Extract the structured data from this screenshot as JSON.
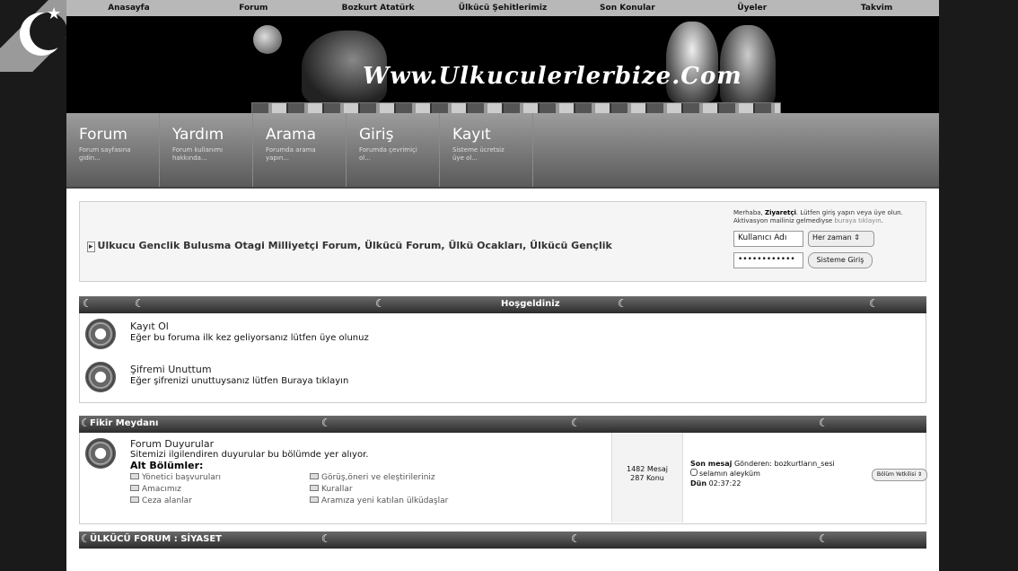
{
  "topnav": [
    "Anasayfa",
    "Forum",
    "Bozkurt Atatürk",
    "Ülkücü Şehitlerimiz",
    "Son Konular",
    "Üyeler",
    "Takvim"
  ],
  "banner": {
    "title": "Www.Ulkuculerlerbize.Com"
  },
  "mainnav": [
    {
      "title": "Forum",
      "sub": "Forum sayfasına gidin..."
    },
    {
      "title": "Yardım",
      "sub": "Forum kullanımı hakkında..."
    },
    {
      "title": "Arama",
      "sub": "Forumda arama yapın..."
    },
    {
      "title": "Giriş",
      "sub": "Forumda çevrimiçi ol..."
    },
    {
      "title": "Kayıt",
      "sub": "Sisteme ücretsiz üye ol..."
    }
  ],
  "login": {
    "site_title": "Ulkucu Genclik Bulusma Otagi Milliyetçi Forum, Ülkücü Forum, Ülkü Ocakları, Ülkücü Gençlik",
    "greeting_pre": "Merhaba, ",
    "greeting_user": "Ziyaretçi",
    "greeting_post": ". Lütfen giriş yapın veya üye olun.",
    "activation_pre": "Aktivasyon mailiniz gelmediyse ",
    "activation_link": "buraya tıklayın",
    "activation_post": ".",
    "username_value": "Kullanıcı Adı",
    "remember_value": "Her zaman",
    "password_value": "••••••••••••",
    "login_button": "Sisteme Giriş"
  },
  "welcome": {
    "title": "Hoşgeldiniz",
    "items": [
      {
        "title": "Kayıt Ol",
        "desc": "Eğer bu foruma ilk kez geliyorsanız lütfen üye olunuz"
      },
      {
        "title": "Şifremi Unuttum",
        "desc": "Eğer şifrenizi unuttuysanız lütfen Buraya tıklayın"
      }
    ]
  },
  "category1": {
    "title": "Fikir Meydanı",
    "forum": {
      "title": "Forum Duyurular",
      "desc": "Sitemizi ilgilendiren duyurular bu bölümde yer alıyor.",
      "sub_label": "Alt Bölümler:",
      "subs": [
        "Yönetici başvuruları",
        "Görüş,öneri ve eleştirileriniz",
        "Amacımız",
        "Kurallar",
        "Ceza alanlar",
        "Aramıza yeni katılan ülküdaşlar"
      ],
      "posts": "1482 Mesaj",
      "topics": "287 Konu",
      "last_label": "Son mesaj",
      "last_sender_pre": "Gönderen: ",
      "last_sender": "bozkurtların_sesi",
      "last_topic": "selamın aleyküm",
      "last_time_label": "Dün",
      "last_time": "02:37:22",
      "moderators": "Bölüm Yetkilisi"
    }
  },
  "category2": {
    "title": "ÜLKÜCÜ FORUM : SİYASET"
  },
  "colors": {
    "bar_dark": "#2c2c2c",
    "bar_light": "#6a6a6a",
    "nav_light": "#9c9c9c",
    "page": "#1a1a1a"
  },
  "icons": [
    "star-icon",
    "crescent-icon",
    "forum-emblem-icon",
    "subforum-icon",
    "chat-bubble-icon"
  ]
}
